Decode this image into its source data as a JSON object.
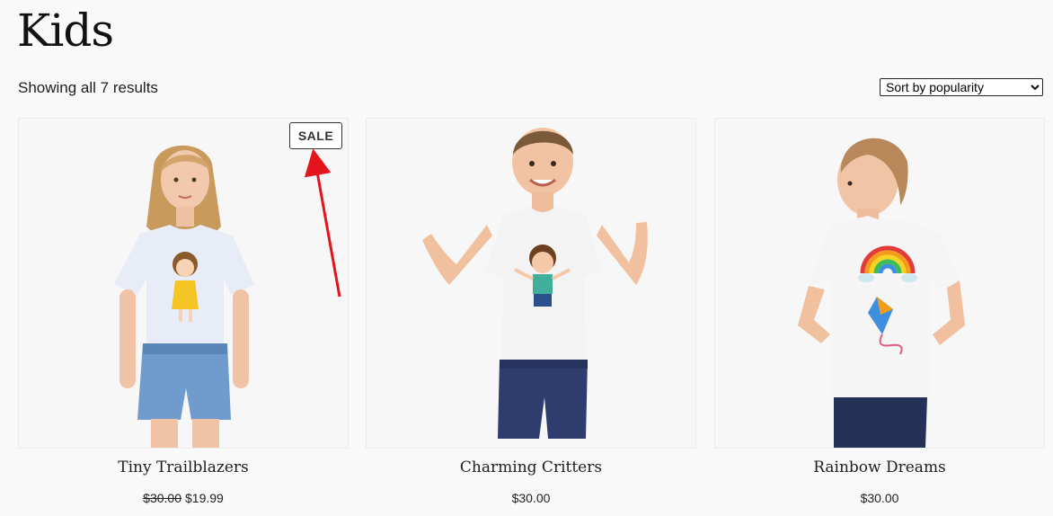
{
  "page": {
    "title": "Kids",
    "result_count": "Showing all 7 results"
  },
  "sort": {
    "selected": "Sort by popularity",
    "options": [
      "Sort by popularity"
    ]
  },
  "products": [
    {
      "name": "Tiny Trailblazers",
      "badge": "SALE",
      "old_price": "$30.00",
      "price": "$19.99",
      "image_icon": "girl-tshirt-photo"
    },
    {
      "name": "Charming Critters",
      "price": "$30.00",
      "image_icon": "boy-tshirt-photo"
    },
    {
      "name": "Rainbow Dreams",
      "price": "$30.00",
      "image_icon": "toddler-tshirt-photo"
    }
  ],
  "colors": {
    "annotation_arrow": "#e3141b",
    "background": "#f9f9f9"
  }
}
